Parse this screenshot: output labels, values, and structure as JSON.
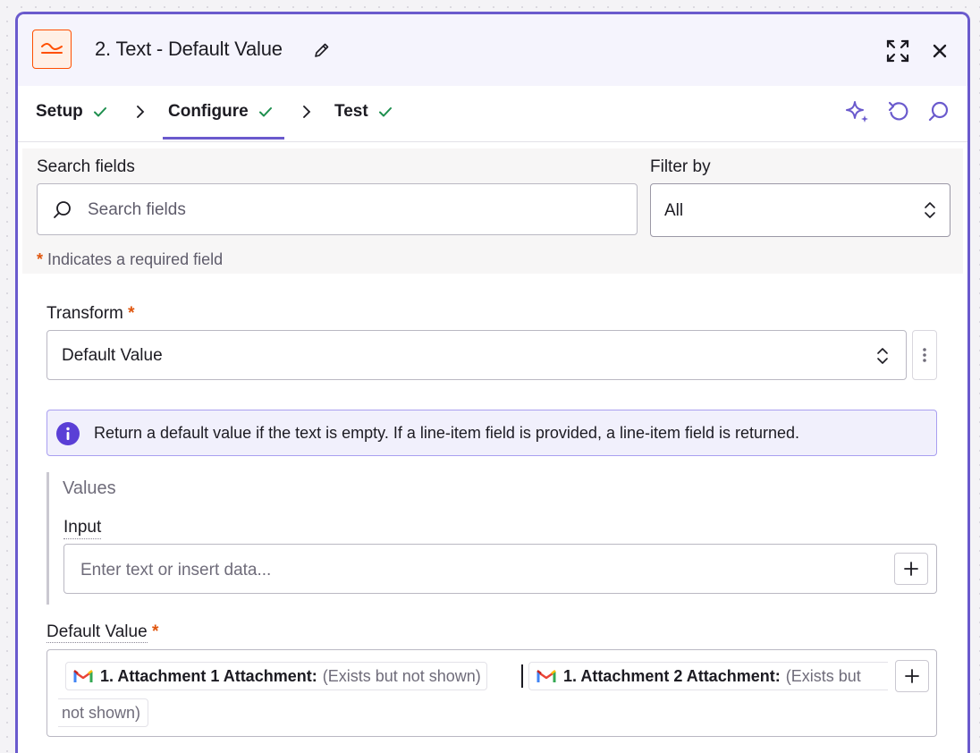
{
  "header": {
    "title": "2. Text - Default Value"
  },
  "tabs": [
    {
      "label": "Setup",
      "complete": true
    },
    {
      "label": "Configure",
      "complete": true,
      "active": true
    },
    {
      "label": "Test",
      "complete": true
    }
  ],
  "search": {
    "label": "Search fields",
    "placeholder": "Search fields",
    "value": ""
  },
  "filter": {
    "label": "Filter by",
    "selected": "All"
  },
  "required_note": {
    "star": "*",
    "text": " Indicates a required field"
  },
  "transform": {
    "label": "Transform",
    "required_star": "*",
    "selected": "Default Value"
  },
  "info": {
    "text": "Return a default value if the text is empty. If a line-item field is provided, a line-item field is returned."
  },
  "values": {
    "title": "Values",
    "input_label": "Input",
    "input_placeholder": "Enter text or insert data..."
  },
  "default_value": {
    "label": "Default Value",
    "required_star": "*",
    "pills": [
      {
        "name": "1. Attachment 1 Attachment:",
        "value": "(Exists but not shown)"
      },
      {
        "name": "1. Attachment 2 Attachment:",
        "value": "(Exists but",
        "continuation": "not shown)"
      }
    ]
  },
  "colors": {
    "accent": "#6a5acd",
    "brand_orange": "#ff4f00",
    "success_green": "#1e8f4e",
    "required_orange": "#e0560e"
  }
}
